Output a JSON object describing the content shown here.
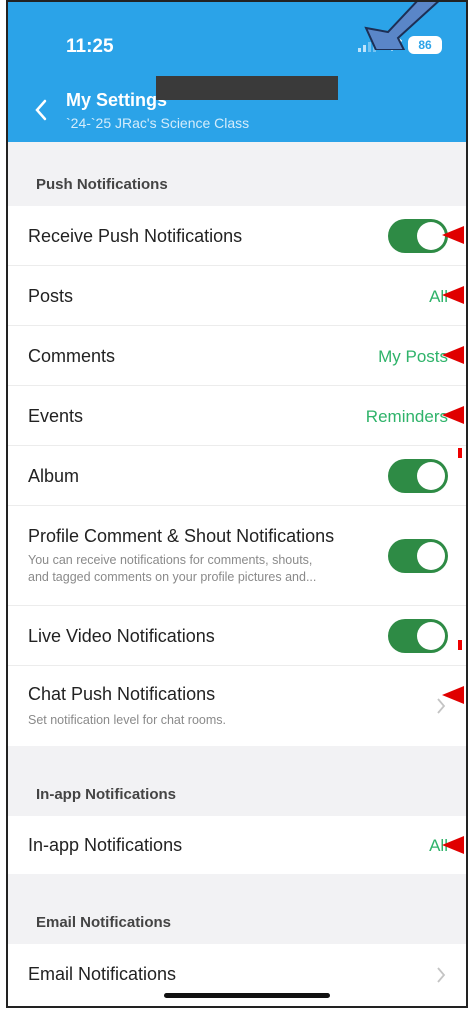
{
  "status_bar": {
    "time": "11:25",
    "battery": "86"
  },
  "header": {
    "back_label": "",
    "title": "My Settings",
    "subtitle": "`24-`25 JRac's Science Class"
  },
  "sections": {
    "push": {
      "label": "Push Notifications",
      "rows": {
        "receive_push": {
          "label": "Receive Push Notifications",
          "toggle": true
        },
        "posts": {
          "label": "Posts",
          "value": "All"
        },
        "comments": {
          "label": "Comments",
          "value": "My Posts"
        },
        "events": {
          "label": "Events",
          "value": "Reminders"
        },
        "album": {
          "label": "Album",
          "toggle": true
        },
        "profile_comment": {
          "label": "Profile Comment & Shout Notifications",
          "desc_line1": "You can receive notifications for comments, shouts,",
          "desc_line2": "and tagged comments on your profile pictures and...",
          "toggle": true
        },
        "live_video": {
          "label": "Live Video Notifications",
          "toggle": true
        },
        "chat_push": {
          "label": "Chat Push Notifications",
          "desc": "Set notification level for chat rooms."
        }
      }
    },
    "in_app": {
      "label": "In-app Notifications",
      "rows": {
        "in_app": {
          "label": "In-app Notifications",
          "value": "All"
        }
      }
    },
    "email": {
      "label": "Email Notifications",
      "rows": {
        "email": {
          "label": "Email Notifications"
        }
      }
    }
  },
  "colors": {
    "header": "#2ba3e8",
    "accent_green": "#2fb36a",
    "toggle_on": "#2e8b45",
    "annotation_red": "#e00000",
    "annotation_blue": "#5a86c8"
  },
  "icons": [
    "back-chevron-icon",
    "signal-icon",
    "wifi-icon",
    "battery-icon",
    "chevron-right-icon",
    "annotation-arrow-icon"
  ]
}
